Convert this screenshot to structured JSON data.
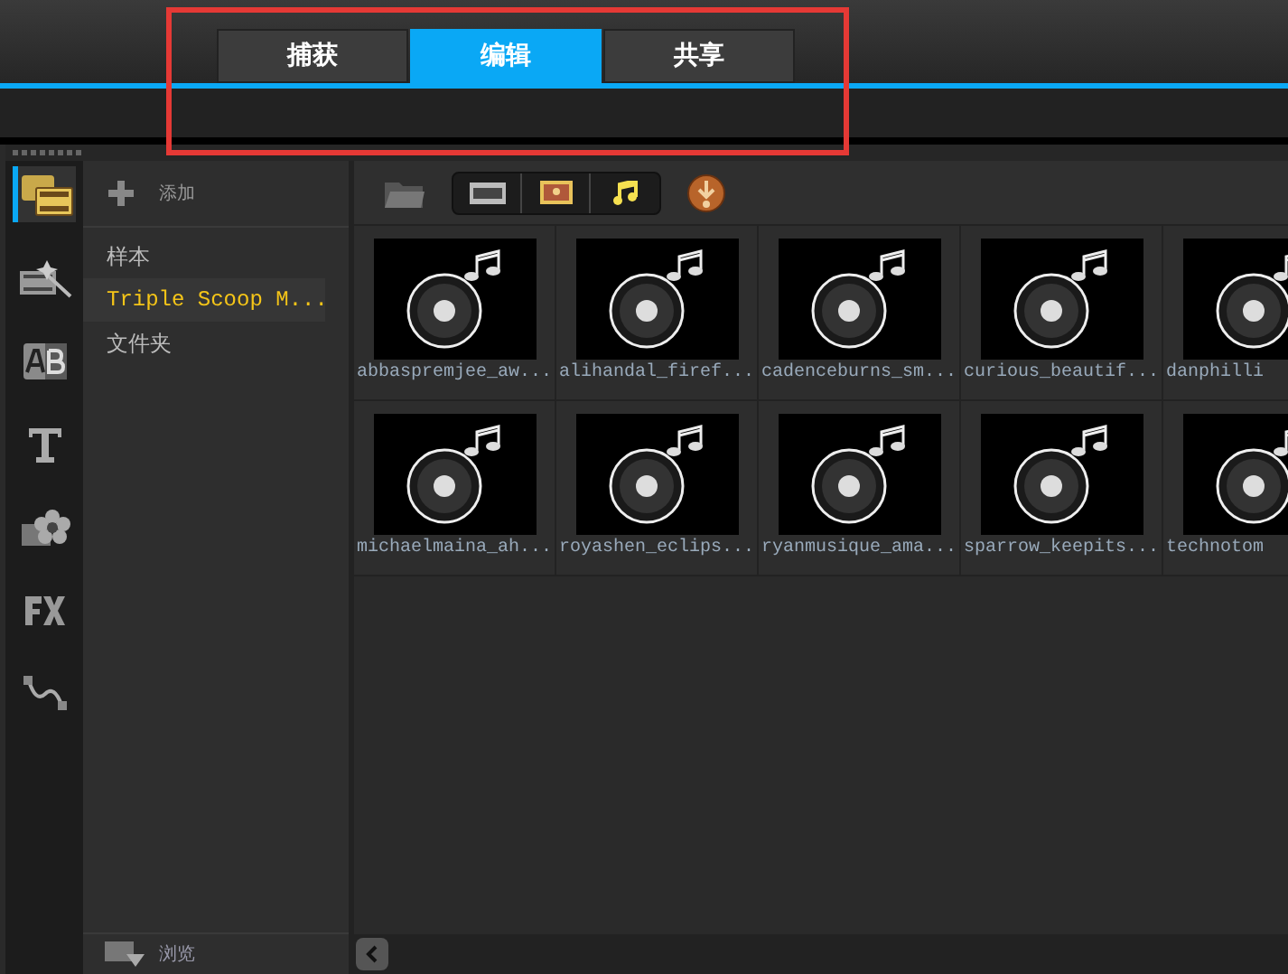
{
  "tabs": [
    {
      "label": "捕获",
      "selected": false
    },
    {
      "label": "编辑",
      "selected": true
    },
    {
      "label": "共享",
      "selected": false
    }
  ],
  "sidebar": {
    "items": [
      {
        "kind": "media",
        "selected": true
      },
      {
        "kind": "instant",
        "selected": false
      },
      {
        "kind": "transition",
        "selected": false
      },
      {
        "kind": "title",
        "selected": false
      },
      {
        "kind": "graphic",
        "selected": false
      },
      {
        "kind": "filter",
        "selected": false
      },
      {
        "kind": "path",
        "selected": false
      }
    ]
  },
  "library": {
    "add_label": "添加",
    "items": [
      {
        "label": "样本",
        "selected": false
      },
      {
        "label": "Triple Scoop M...",
        "selected": true
      },
      {
        "label": "文件夹",
        "selected": false
      }
    ],
    "browse_label": "浏览"
  },
  "media": {
    "items": [
      {
        "name": "abbaspremjee_aw..."
      },
      {
        "name": "alihandal_firef..."
      },
      {
        "name": "cadenceburns_sm..."
      },
      {
        "name": "curious_beautif..."
      },
      {
        "name": "danphilli"
      },
      {
        "name": "michaelmaina_ah..."
      },
      {
        "name": "royashen_eclips..."
      },
      {
        "name": "ryanmusique_ama..."
      },
      {
        "name": "sparrow_keepits..."
      },
      {
        "name": "technotom"
      }
    ]
  }
}
